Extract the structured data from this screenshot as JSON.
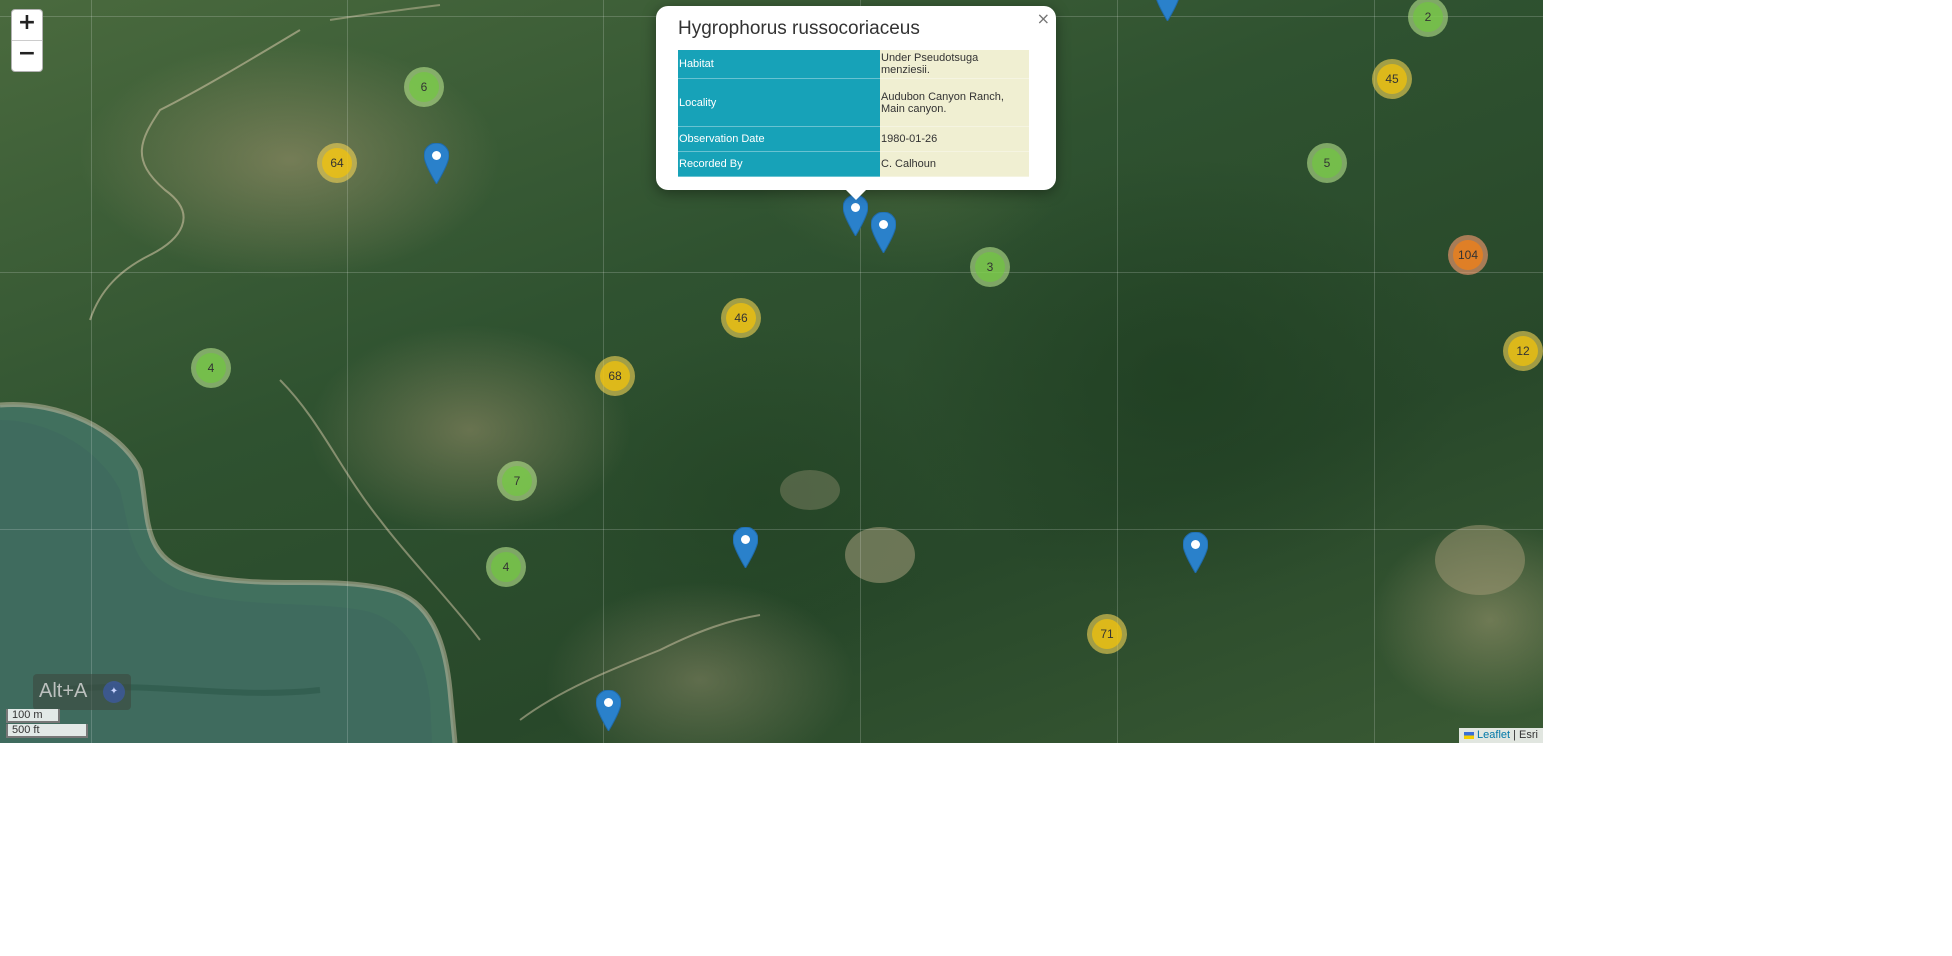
{
  "zoom": {
    "in_label": "+",
    "out_label": "−"
  },
  "popup": {
    "title": "Hygrophorus russocoriaceus",
    "close_label": "×",
    "rows": [
      {
        "key": "Habitat",
        "value": "Under Pseudotsuga menziesii."
      },
      {
        "key": "Locality",
        "value": "Audubon Canyon Ranch, Main canyon."
      },
      {
        "key": "Observation Date",
        "value": "1980-01-26"
      },
      {
        "key": "Recorded By",
        "value": "C. Calhoun"
      }
    ]
  },
  "clusters": [
    "2",
    "45",
    "6",
    "64",
    "5",
    "104",
    "3",
    "46",
    "12",
    "4",
    "68",
    "7",
    "4",
    "71"
  ],
  "overlay": {
    "shortcut": "Alt+A"
  },
  "scale": {
    "metric": "100 m",
    "imperial": "500 ft"
  },
  "attribution": {
    "leaflet": "Leaflet",
    "separator": "|",
    "provider": "Esri"
  }
}
